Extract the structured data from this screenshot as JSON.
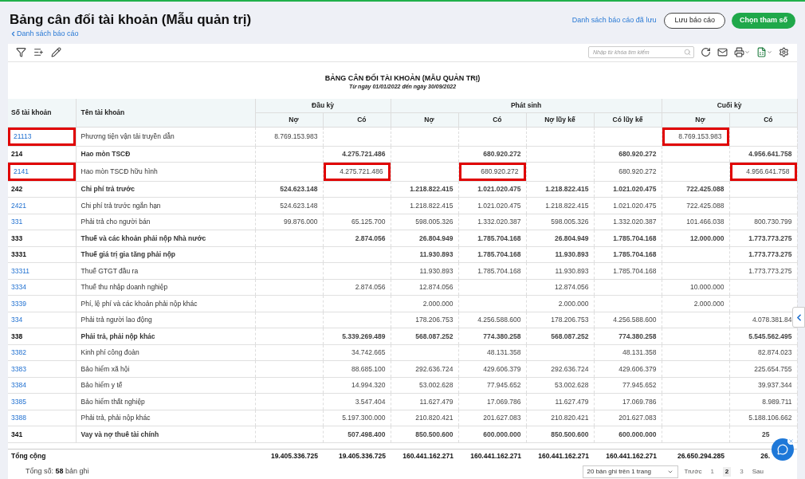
{
  "header": {
    "title": "Bảng cân đối tài khoản (Mẫu quản trị)",
    "back_link": "Danh sách báo cáo",
    "saved_link": "Danh sách báo cáo đã lưu",
    "save_button": "Lưu báo cáo",
    "params_button": "Chọn tham số"
  },
  "search": {
    "placeholder": "Nhập từ khóa tìm kiếm"
  },
  "report": {
    "title": "BẢNG CÂN ĐỐI TÀI KHOẢN (MẪU QUẢN TRỊ)",
    "subtitle": "Từ ngày 01/01/2022 đến ngày 30/09/2022"
  },
  "table": {
    "columns": [
      "Số tài khoản",
      "Tên tài khoản"
    ],
    "groups": [
      {
        "label": "Đầu kỳ",
        "sub": [
          "Nợ",
          "Có"
        ]
      },
      {
        "label": "Phát sinh",
        "sub": [
          "Nợ",
          "Có",
          "Nợ lũy kế",
          "Có lũy kế"
        ]
      },
      {
        "label": "Cuối kỳ",
        "sub": [
          "Nợ",
          "Có"
        ]
      }
    ],
    "rows": [
      {
        "bold": false,
        "highlighted": [
          true,
          false,
          false,
          false,
          false,
          false,
          false,
          false,
          true,
          false
        ],
        "cells": [
          "21113",
          "Phương tiện vận tải truyền dẫn",
          "8.769.153.983",
          null,
          null,
          null,
          null,
          null,
          "8.769.153.983",
          null
        ]
      },
      {
        "bold": true,
        "highlighted": [
          false,
          false,
          false,
          false,
          false,
          false,
          false,
          false,
          false,
          false
        ],
        "cells": [
          "214",
          "Hao mòn TSCĐ",
          null,
          "4.275.721.486",
          null,
          "680.920.272",
          null,
          "680.920.272",
          null,
          "4.956.641.758"
        ]
      },
      {
        "bold": false,
        "highlighted": [
          true,
          false,
          false,
          true,
          false,
          true,
          false,
          false,
          false,
          true
        ],
        "cells": [
          "2141",
          "Hao mòn TSCĐ hữu hình",
          null,
          "4.275.721.486",
          null,
          "680.920.272",
          null,
          "680.920.272",
          null,
          "4.956.641.758"
        ]
      },
      {
        "bold": true,
        "highlighted": [
          false,
          false,
          false,
          false,
          false,
          false,
          false,
          false,
          false,
          false
        ],
        "cells": [
          "242",
          "Chi phí trả trước",
          "524.623.148",
          null,
          "1.218.822.415",
          "1.021.020.475",
          "1.218.822.415",
          "1.021.020.475",
          "722.425.088",
          null
        ]
      },
      {
        "bold": false,
        "highlighted": [
          false,
          false,
          false,
          false,
          false,
          false,
          false,
          false,
          false,
          false
        ],
        "cells": [
          "2421",
          "Chi phí trả trước ngắn hạn",
          "524.623.148",
          null,
          "1.218.822.415",
          "1.021.020.475",
          "1.218.822.415",
          "1.021.020.475",
          "722.425.088",
          null
        ]
      },
      {
        "bold": false,
        "highlighted": [
          false,
          false,
          false,
          false,
          false,
          false,
          false,
          false,
          false,
          false
        ],
        "cells": [
          "331",
          "Phải trả cho người bán",
          "99.876.000",
          "65.125.700",
          "598.005.326",
          "1.332.020.387",
          "598.005.326",
          "1.332.020.387",
          "101.466.038",
          "800.730.799"
        ]
      },
      {
        "bold": true,
        "highlighted": [
          false,
          false,
          false,
          false,
          false,
          false,
          false,
          false,
          false,
          false
        ],
        "cells": [
          "333",
          "Thuế và các khoản phải nộp Nhà nước",
          null,
          "2.874.056",
          "26.804.949",
          "1.785.704.168",
          "26.804.949",
          "1.785.704.168",
          "12.000.000",
          "1.773.773.275"
        ]
      },
      {
        "bold": true,
        "highlighted": [
          false,
          false,
          false,
          false,
          false,
          false,
          false,
          false,
          false,
          false
        ],
        "cells": [
          "3331",
          "Thuế giá trị gia tăng phải nộp",
          null,
          null,
          "11.930.893",
          "1.785.704.168",
          "11.930.893",
          "1.785.704.168",
          null,
          "1.773.773.275"
        ]
      },
      {
        "bold": false,
        "highlighted": [
          false,
          false,
          false,
          false,
          false,
          false,
          false,
          false,
          false,
          false
        ],
        "cells": [
          "33311",
          "Thuế GTGT đầu ra",
          null,
          null,
          "11.930.893",
          "1.785.704.168",
          "11.930.893",
          "1.785.704.168",
          null,
          "1.773.773.275"
        ]
      },
      {
        "bold": false,
        "highlighted": [
          false,
          false,
          false,
          false,
          false,
          false,
          false,
          false,
          false,
          false
        ],
        "cells": [
          "3334",
          "Thuế thu nhập doanh nghiệp",
          null,
          "2.874.056",
          "12.874.056",
          null,
          "12.874.056",
          null,
          "10.000.000",
          null
        ]
      },
      {
        "bold": false,
        "highlighted": [
          false,
          false,
          false,
          false,
          false,
          false,
          false,
          false,
          false,
          false
        ],
        "cells": [
          "3339",
          "Phí, lệ phí và các khoản phải nộp khác",
          null,
          null,
          "2.000.000",
          null,
          "2.000.000",
          null,
          "2.000.000",
          null
        ]
      },
      {
        "bold": false,
        "highlighted": [
          false,
          false,
          false,
          false,
          false,
          false,
          false,
          false,
          false,
          false
        ],
        "cells": [
          "334",
          "Phải trả người lao động",
          null,
          null,
          "178.206.753",
          "4.256.588.600",
          "178.206.753",
          "4.256.588.600",
          null,
          "4.078.381.84"
        ]
      },
      {
        "bold": true,
        "highlighted": [
          false,
          false,
          false,
          false,
          false,
          false,
          false,
          false,
          false,
          false
        ],
        "cells": [
          "338",
          "Phải trả, phải nộp khác",
          null,
          "5.339.269.489",
          "568.087.252",
          "774.380.258",
          "568.087.252",
          "774.380.258",
          null,
          "5.545.562.495"
        ]
      },
      {
        "bold": false,
        "highlighted": [
          false,
          false,
          false,
          false,
          false,
          false,
          false,
          false,
          false,
          false
        ],
        "cells": [
          "3382",
          "Kinh phí công đoàn",
          null,
          "34.742.665",
          null,
          "48.131.358",
          null,
          "48.131.358",
          null,
          "82.874.023"
        ]
      },
      {
        "bold": false,
        "highlighted": [
          false,
          false,
          false,
          false,
          false,
          false,
          false,
          false,
          false,
          false
        ],
        "cells": [
          "3383",
          "Bảo hiểm xã hội",
          null,
          "88.685.100",
          "292.636.724",
          "429.606.379",
          "292.636.724",
          "429.606.379",
          null,
          "225.654.755"
        ]
      },
      {
        "bold": false,
        "highlighted": [
          false,
          false,
          false,
          false,
          false,
          false,
          false,
          false,
          false,
          false
        ],
        "cells": [
          "3384",
          "Bảo hiểm y tế",
          null,
          "14.994.320",
          "53.002.628",
          "77.945.652",
          "53.002.628",
          "77.945.652",
          null,
          "39.937.344"
        ]
      },
      {
        "bold": false,
        "highlighted": [
          false,
          false,
          false,
          false,
          false,
          false,
          false,
          false,
          false,
          false
        ],
        "cells": [
          "3385",
          "Bảo hiểm thất nghiệp",
          null,
          "3.547.404",
          "11.627.479",
          "17.069.786",
          "11.627.479",
          "17.069.786",
          null,
          "8.989.711"
        ]
      },
      {
        "bold": false,
        "highlighted": [
          false,
          false,
          false,
          false,
          false,
          false,
          false,
          false,
          false,
          false
        ],
        "cells": [
          "3388",
          "Phải trả, phải nộp khác",
          null,
          "5.197.300.000",
          "210.820.421",
          "201.627.083",
          "210.820.421",
          "201.627.083",
          null,
          "5.188.106.662"
        ]
      },
      {
        "bold": true,
        "highlighted": [
          false,
          false,
          false,
          false,
          false,
          false,
          false,
          false,
          false,
          false
        ],
        "cells": [
          "341",
          "Vay và nợ thuê tài chính",
          null,
          "507.498.400",
          "850.500.600",
          "600.000.000",
          "850.500.600",
          "600.000.000",
          null,
          "25"
        ]
      }
    ],
    "total": {
      "label": "Tổng cộng",
      "values": [
        "19.405.336.725",
        "19.405.336.725",
        "160.441.162.271",
        "160.441.162.271",
        "160.441.162.271",
        "160.441.162.271",
        "26.650.294.285",
        "26."
      ]
    }
  },
  "footer": {
    "count_label": "Tổng số:",
    "count": "58",
    "count_unit": "bản ghi",
    "page_size": "20 bản ghi trên 1 trang",
    "prev": "Trước",
    "pages": [
      {
        "label": "1",
        "selected": false
      },
      {
        "label": "2",
        "selected": true
      },
      {
        "label": "3",
        "selected": false
      }
    ],
    "next": "Sau"
  }
}
